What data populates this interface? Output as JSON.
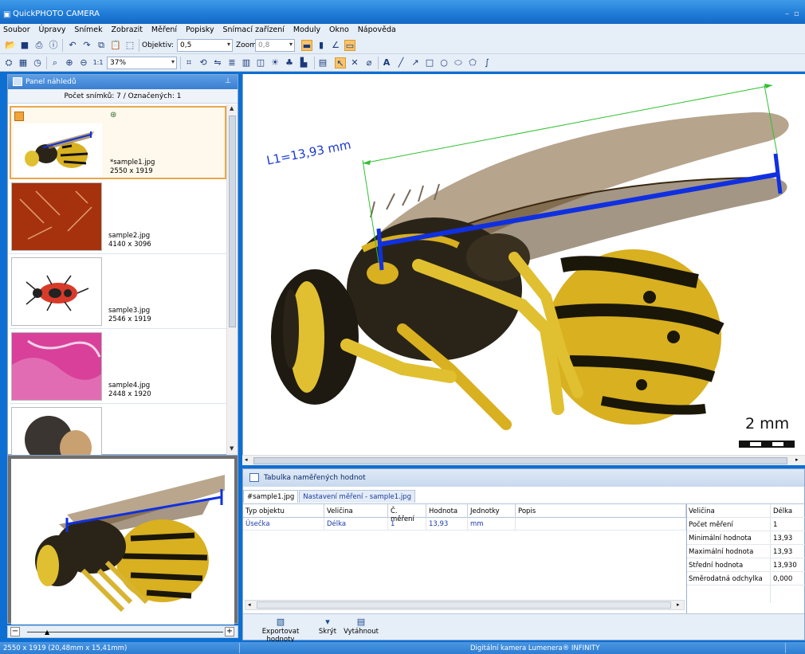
{
  "window": {
    "title": "QuickPHOTO CAMERA",
    "min": "–",
    "max": "▫"
  },
  "menu": [
    "Soubor",
    "Úpravy",
    "Snímek",
    "Zobrazit",
    "Měření",
    "Popisky",
    "Snímací zařízení",
    "Moduly",
    "Okno",
    "Nápověda"
  ],
  "toolbar1": {
    "objective_label": "Objektiv:",
    "objective_value": "0,5",
    "zoom_label": "Zoom:",
    "zoom_value": "0,8"
  },
  "toolbar2": {
    "zoom_percent": "37%",
    "one_to_one": "1:1",
    "text_tool": "A"
  },
  "thumb_panel": {
    "title": "Panel náhledů",
    "count_text": "Počet snímků: 7 / Označených: 1",
    "items": [
      {
        "name": "*sample1.jpg",
        "dims": "2550 x 1919",
        "selected": true
      },
      {
        "name": "sample2.jpg",
        "dims": "4140 x 3096"
      },
      {
        "name": "sample3.jpg",
        "dims": "2546 x 1919"
      },
      {
        "name": "sample4.jpg",
        "dims": "2448 x 1920"
      },
      {
        "name": "",
        "dims": ""
      }
    ]
  },
  "image_view": {
    "measure_label": "L1=13,93 mm",
    "scalebar_label": "2 mm"
  },
  "measure_table": {
    "title": "Tabulka naměřených hodnot",
    "tabs": [
      "#sample1.jpg",
      "Nastavení měření - sample1.jpg"
    ],
    "columns": [
      "Typ objektu",
      "Veličina",
      "Č. měření",
      "Hodnota",
      "Jednotky",
      "Popis"
    ],
    "rows": [
      [
        "Úsečka",
        "Délka",
        "1",
        "13,93",
        "mm",
        ""
      ]
    ],
    "stats": [
      [
        "Veličina",
        "Délka"
      ],
      [
        "Počet měření",
        "1"
      ],
      [
        "Minimální hodnota",
        "13,93"
      ],
      [
        "Maximální hodnota",
        "13,93"
      ],
      [
        "Střední hodnota",
        "13,930"
      ],
      [
        "Směrodatná odchylka",
        "0,000"
      ]
    ],
    "actions": [
      "Exportovat hodnoty",
      "Skrýt",
      "Vytáhnout"
    ]
  },
  "status": {
    "left": "2550 x 1919 (20,48mm x 15,41mm)",
    "right": "Digitální kamera Lumenera® INFINITY"
  },
  "colors": {
    "accent": "#1e7ad6",
    "measure_blue": "#1030e0",
    "measure_green": "#30c030",
    "selection_orange": "#e7a64e"
  }
}
